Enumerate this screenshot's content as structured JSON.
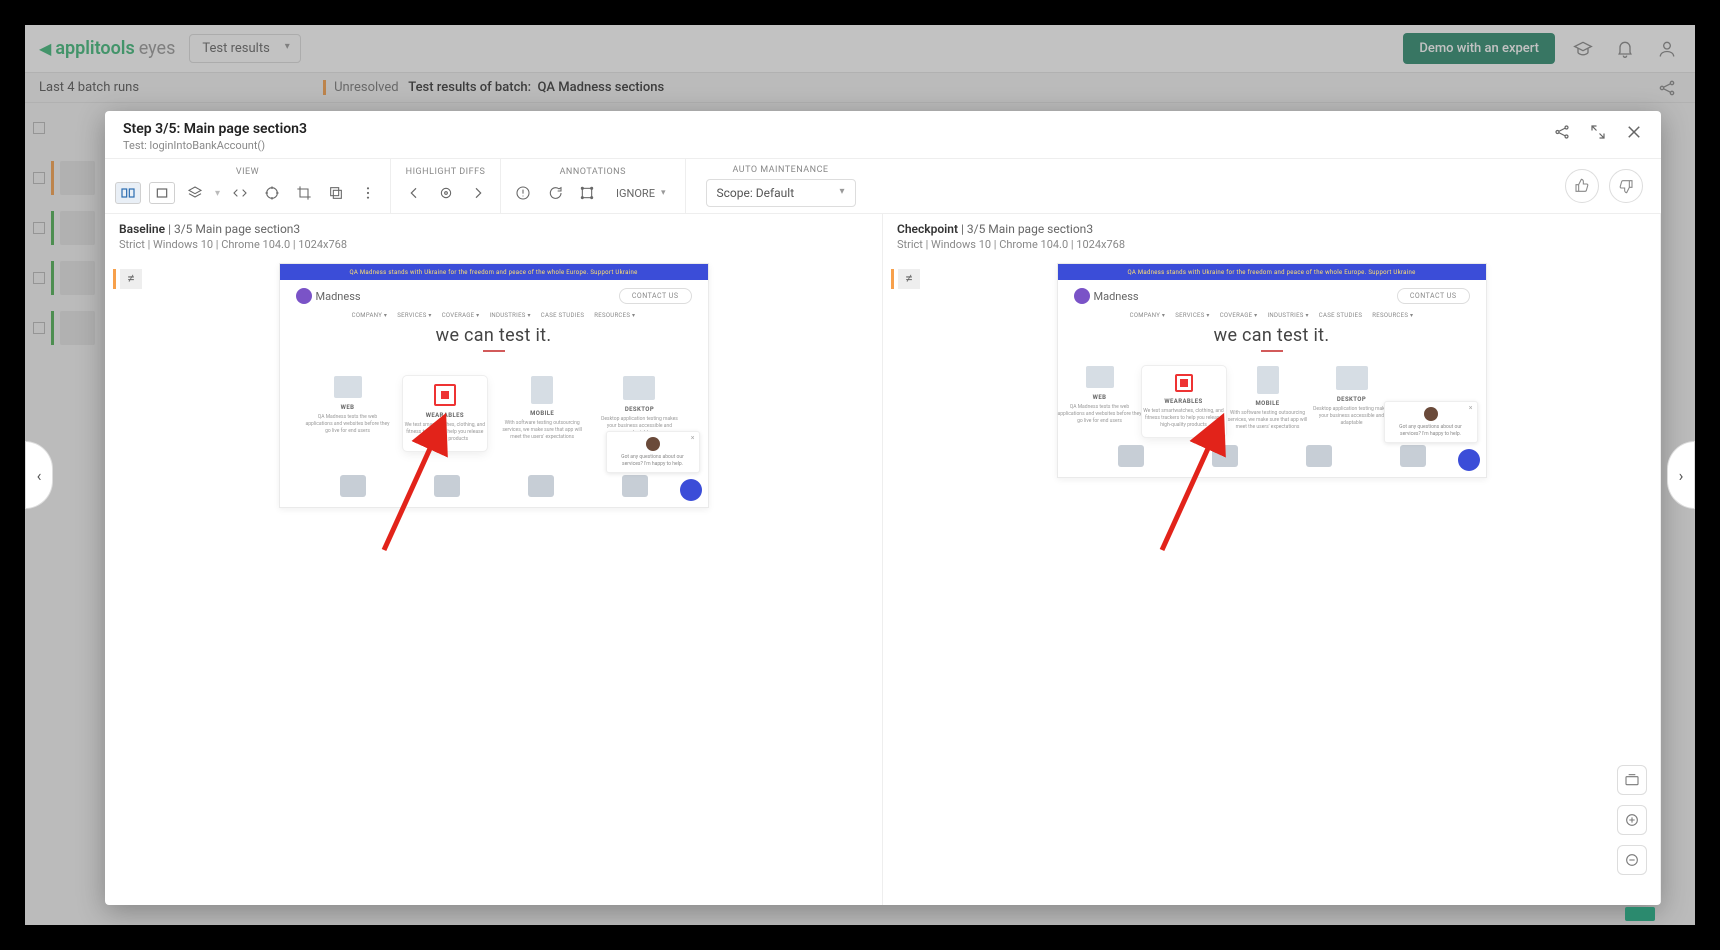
{
  "header": {
    "logo1": "applitools",
    "logo2": "eyes",
    "results_select": "Test results",
    "demo_button": "Demo with an expert"
  },
  "subheader": {
    "last_runs": "Last 4 batch runs",
    "unresolved": "Unresolved",
    "results_of": "Test results of batch:",
    "batch_name": "QA Madness sections"
  },
  "modal": {
    "step_prefix": "Step 3/5:",
    "step_name": "Main page section3",
    "test_label": "Test: loginIntoBankAccount()"
  },
  "toolbar": {
    "view": "VIEW",
    "highlight": "HIGHLIGHT DIFFS",
    "annotations": "ANNOTATIONS",
    "automaint": "AUTO MAINTENANCE",
    "ignore": "IGNORE",
    "scope": "Scope: Default"
  },
  "panes": {
    "baseline": "Baseline",
    "checkpoint": "Checkpoint",
    "sep": " | ",
    "step_desc": "3/5 Main page section3",
    "meta": "Strict | Windows 10 | Chrome 104.0 | 1024x768"
  },
  "shot": {
    "banner": "QA Madness stands with Ukraine for the freedom and peace of the whole Europe. Support Ukraine",
    "brand": "Madness",
    "contact": "CONTACT US",
    "nav": [
      "COMPANY ▾",
      "SERVICES ▾",
      "COVERAGE ▾",
      "INDUSTRIES ▾",
      "CASE STUDIES",
      "RESOURCES ▾"
    ],
    "hero": "we can test it.",
    "cards": [
      {
        "t": "WEB",
        "b": "QA Madness tests the web applications and websites before they go live for end users"
      },
      {
        "t": "WEARABLES",
        "b": "We test smartwatches, clothing, and fitness trackers to help you release high-quality products"
      },
      {
        "t": "MOBILE",
        "b": "With software testing outsourcing services, we make sure that app will meet the users' expectations"
      },
      {
        "t": "DESKTOP",
        "b": "Desktop application testing makes your business accessible and adaptable"
      }
    ],
    "tip": "Got any questions about our services? I'm happy to help."
  }
}
